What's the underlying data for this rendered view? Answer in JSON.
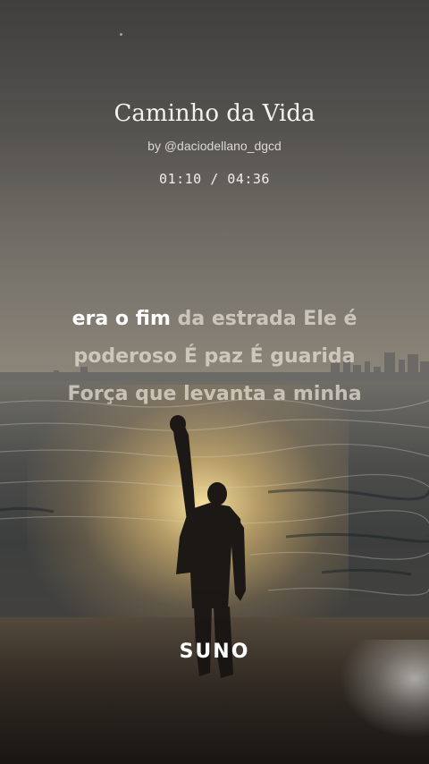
{
  "song": {
    "title": "Caminho da Vida",
    "artist": "by @daciodellano_dgcd",
    "time": "01:10 / 04:36"
  },
  "lyrics": {
    "line1_sung": "era o fim",
    "line1_unsung": " da estrada Ele é",
    "line2": "poderoso É paz É guarida",
    "line3": "Força que levanta a minha"
  },
  "brand": {
    "logo": "SUNO"
  },
  "colors": {
    "sung_text": "#ffffff",
    "unsung_text": "#e8e2d6",
    "sun": "#ffe6a0"
  }
}
